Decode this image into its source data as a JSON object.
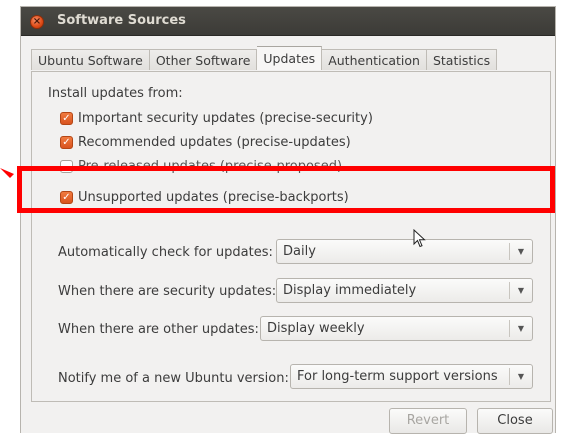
{
  "window": {
    "title": "Software Sources"
  },
  "tabs": [
    {
      "label": "Ubuntu Software"
    },
    {
      "label": "Other Software"
    },
    {
      "label": "Updates"
    },
    {
      "label": "Authentication"
    },
    {
      "label": "Statistics"
    }
  ],
  "install": {
    "heading": "Install updates from:",
    "items": [
      {
        "label": "Important security updates (precise-security)",
        "checked": true
      },
      {
        "label": "Recommended updates (precise-updates)",
        "checked": true
      },
      {
        "label": "Pre-released updates (precise-proposed)",
        "checked": false
      },
      {
        "label": "Unsupported updates (precise-backports)",
        "checked": true
      }
    ]
  },
  "settings": {
    "auto_check": {
      "label": "Automatically check for updates:",
      "value": "Daily"
    },
    "security": {
      "label": "When there are security updates:",
      "value": "Display immediately"
    },
    "other": {
      "label": "When there are other updates:",
      "value": "Display weekly"
    },
    "notify": {
      "label": "Notify me of a new Ubuntu version:",
      "value": "For long-term support versions"
    }
  },
  "buttons": {
    "revert": "Revert",
    "close": "Close"
  },
  "colors": {
    "highlight": "#ff0000",
    "checkbox": "#e0581e",
    "titlebar": "#3c3b37"
  }
}
